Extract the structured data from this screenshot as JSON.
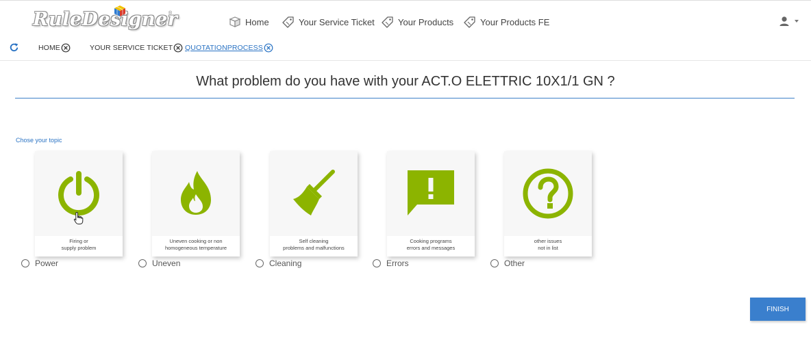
{
  "brand": {
    "name": "RuleDesigner",
    "reg_mark": "®"
  },
  "nav": {
    "items": [
      {
        "label": "Home",
        "icon": "box-icon"
      },
      {
        "label": "Your Service Ticket",
        "icon": "tag-icon"
      },
      {
        "label": "Your Products",
        "icon": "tag-icon"
      },
      {
        "label": "Your Products FE",
        "icon": "tag-icon"
      }
    ],
    "user_icon": "user-icon"
  },
  "tabs": [
    {
      "label": "HOME",
      "active": false
    },
    {
      "label": "YOUR SERVICE TICKET",
      "active": false
    },
    {
      "label": "QUOTATIONPROCESS",
      "active": true
    }
  ],
  "question": "What problem do you have with your ACT.O ELETTRIC 10X1/1 GN ?",
  "topic_label": "Chose your topic",
  "topics": [
    {
      "icon": "power-icon",
      "caption": [
        "Firing or",
        "supply problem"
      ],
      "option": "Power"
    },
    {
      "icon": "flame-icon",
      "caption": [
        "Uneven cooking or non",
        "homogeneous temperature"
      ],
      "option": "Uneven"
    },
    {
      "icon": "broom-icon",
      "caption": [
        "Self cleaning",
        "problems and malfunctions"
      ],
      "option": "Cleaning"
    },
    {
      "icon": "alert-message-icon",
      "caption": [
        "Cooking programs",
        "errors and messages"
      ],
      "option": "Errors"
    },
    {
      "icon": "question-icon",
      "caption": [
        "other issues",
        "not in list"
      ],
      "option": "Other"
    }
  ],
  "finish_label": "FINISH",
  "colors": {
    "accent": "#3a7fcd",
    "icon_green": "#8cb400",
    "link_blue": "#2a73c4"
  }
}
